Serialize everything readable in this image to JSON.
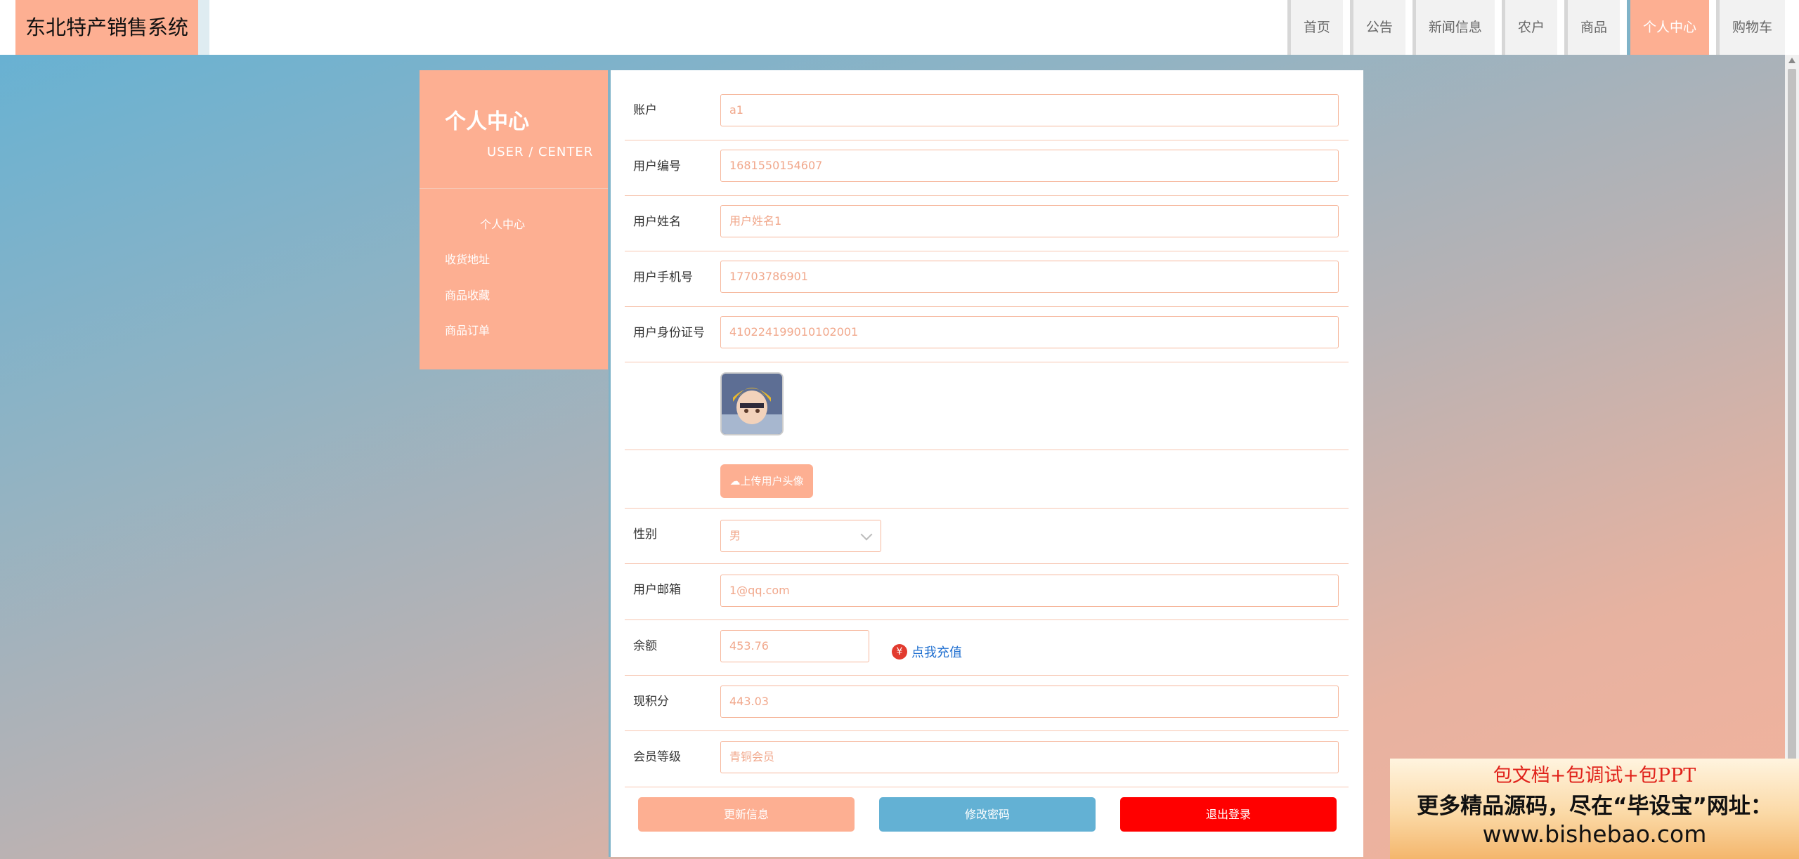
{
  "brand": "东北特产销售系统",
  "nav": [
    {
      "label": "首页",
      "active": false
    },
    {
      "label": "公告",
      "active": false
    },
    {
      "label": "新闻信息",
      "active": false
    },
    {
      "label": "农户",
      "active": false
    },
    {
      "label": "商品",
      "active": false
    },
    {
      "label": "个人中心",
      "active": true
    },
    {
      "label": "购物车",
      "active": false
    }
  ],
  "sidebar": {
    "title": "个人中心",
    "subtitle": "USER / CENTER",
    "items": [
      "个人中心",
      "收货地址",
      "商品收藏",
      "商品订单"
    ]
  },
  "form": {
    "account": {
      "label": "账户",
      "value": "a1"
    },
    "user_no": {
      "label": "用户编号",
      "value": "1681550154607"
    },
    "user_name": {
      "label": "用户姓名",
      "value": "用户姓名1"
    },
    "phone": {
      "label": "用户手机号",
      "value": "17703786901"
    },
    "id_card": {
      "label": "用户身份证号",
      "value": "410224199010102001"
    },
    "upload_label": "上传用户头像",
    "gender": {
      "label": "性别",
      "value": "男"
    },
    "email": {
      "label": "用户邮箱",
      "value": "1@qq.com"
    },
    "balance": {
      "label": "余额",
      "value": "453.76"
    },
    "recharge_label": "点我充值",
    "points": {
      "label": "现积分",
      "value": "443.03"
    },
    "level": {
      "label": "会员等级",
      "value": "青铜会员"
    }
  },
  "buttons": {
    "update": "更新信息",
    "change_password": "修改密码",
    "logout": "退出登录"
  },
  "ad": {
    "line1": "包文档+包调试+包PPT",
    "line2": "更多精品源码，尽在“毕设宝”网址：",
    "line3": "www.bishebao.com"
  },
  "colors": {
    "accent": "#fdaf92",
    "blue": "#63b1d4",
    "danger": "#ff0000"
  }
}
